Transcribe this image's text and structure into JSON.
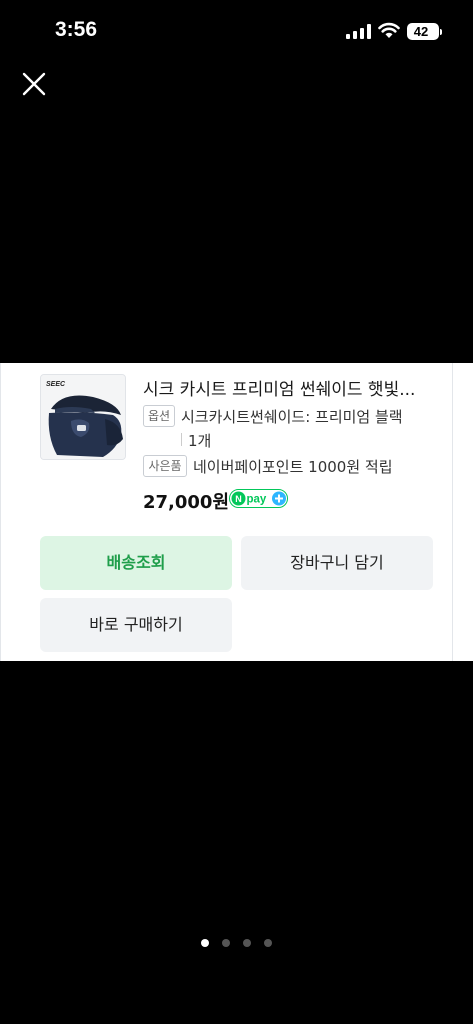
{
  "status_bar": {
    "time": "3:56",
    "battery": "42"
  },
  "product": {
    "title": "시크 카시트 프리미엄 썬쉐이드 햇빛...",
    "brand_mark": "SEEC",
    "option_tag": "옵션",
    "option_value": "시크카시트썬쉐이드: 프리미엄 블랙",
    "quantity": "1개",
    "gift_tag": "사은품",
    "gift_value": "네이버페이포인트 1000원 적립",
    "price": "27,000원",
    "npay_text": "pay"
  },
  "buttons": {
    "delivery": "배송조회",
    "cart": "장바구니 담기",
    "buy_now": "바로 구매하기"
  },
  "pagination": {
    "total": 4,
    "active": 1
  },
  "colors": {
    "accent_green": "#1e9e4a",
    "delivery_bg": "#ddf5e4",
    "npay_green": "#03c75a",
    "npay_blue": "#2db6ff"
  }
}
